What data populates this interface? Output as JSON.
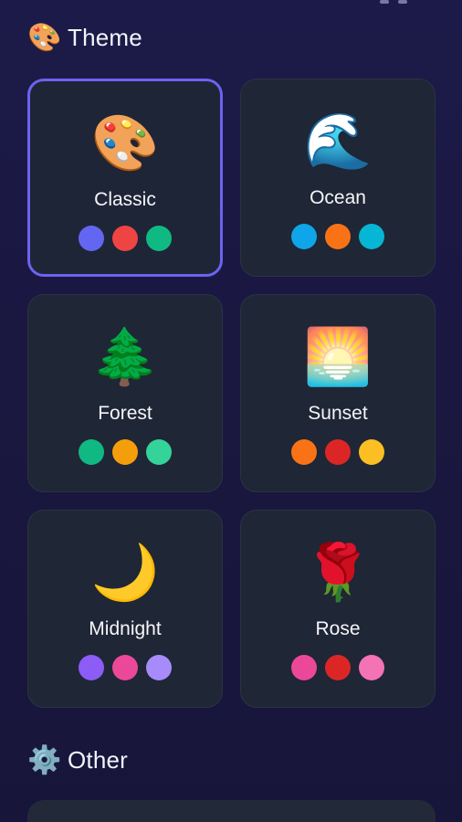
{
  "theme_section": {
    "icon": "palette-icon",
    "emoji": "🎨",
    "title": "Theme"
  },
  "themes": [
    {
      "name": "Classic",
      "icon": "palette-icon",
      "emoji": "🎨",
      "selected": true,
      "colors": [
        "#6366f1",
        "#ef4444",
        "#10b981"
      ]
    },
    {
      "name": "Ocean",
      "icon": "wave-icon",
      "emoji": "🌊",
      "selected": false,
      "colors": [
        "#0ea5e9",
        "#f97316",
        "#06b6d4"
      ]
    },
    {
      "name": "Forest",
      "icon": "tree-icon",
      "emoji": "🌲",
      "selected": false,
      "colors": [
        "#10b981",
        "#f59e0b",
        "#34d399"
      ]
    },
    {
      "name": "Sunset",
      "icon": "sunrise-icon",
      "emoji": "🌅",
      "selected": false,
      "colors": [
        "#f97316",
        "#dc2626",
        "#fbbf24"
      ]
    },
    {
      "name": "Midnight",
      "icon": "moon-icon",
      "emoji": "🌙",
      "selected": false,
      "colors": [
        "#8b5cf6",
        "#ec4899",
        "#a78bfa"
      ]
    },
    {
      "name": "Rose",
      "icon": "rose-icon",
      "emoji": "🌹",
      "selected": false,
      "colors": [
        "#ec4899",
        "#dc2626",
        "#f472b6"
      ]
    }
  ],
  "other_section": {
    "icon": "gear-icon",
    "emoji": "⚙️",
    "title": "Other"
  },
  "colors": {
    "accent": "#6c63f0",
    "card_bg": "#1f2635",
    "page_bg": "#1a1840"
  }
}
